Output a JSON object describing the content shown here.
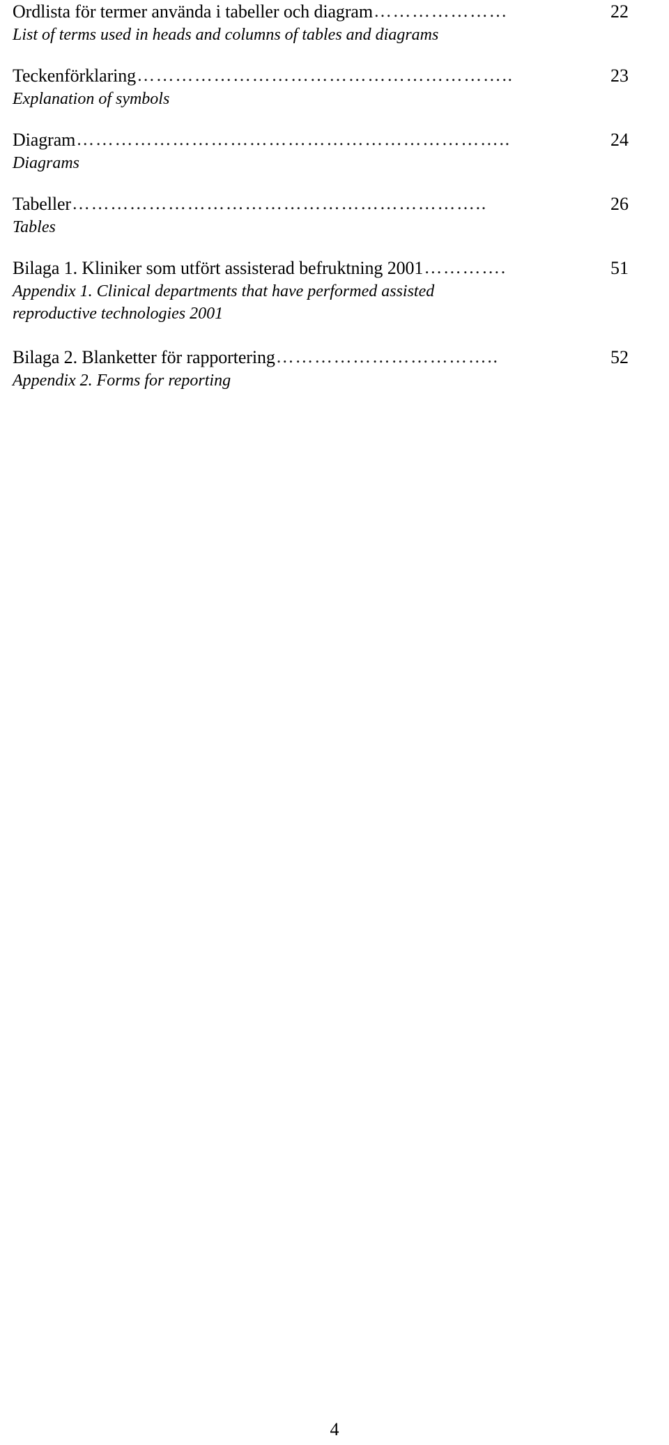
{
  "document": {
    "type": "table-of-contents",
    "page_number": "4",
    "leader_dot_char": "."
  },
  "entries": [
    {
      "title_sv": "Ordlista för termer använda i tabeller och diagram",
      "dots": "…………………",
      "page": "22",
      "translation_lines": [
        "List of terms used in heads and columns of tables and diagrams"
      ]
    },
    {
      "title_sv": "Teckenförklaring",
      "dots": "…………………………………………………..",
      "page": "23",
      "translation_lines": [
        "Explanation of symbols"
      ]
    },
    {
      "title_sv": "Diagram",
      "dots": "…………………………………………………………..",
      "page": "24",
      "translation_lines": [
        "Diagrams"
      ]
    },
    {
      "title_sv": "Tabeller",
      "dots": "………………………………………………………..",
      "page": "26",
      "translation_lines": [
        "Tables"
      ]
    },
    {
      "title_sv": "Bilaga 1. Kliniker som utfört assisterad befruktning 2001",
      "dots": "………….",
      "page": "51",
      "translation_lines": [
        "Appendix 1. Clinical departments that have performed assisted",
        "reproductive technologies 2001"
      ]
    },
    {
      "title_sv": "Bilaga 2. Blanketter för rapportering",
      "dots": "……………………………..",
      "page": "52",
      "translation_lines": [
        "Appendix 2. Forms for reporting"
      ]
    }
  ]
}
